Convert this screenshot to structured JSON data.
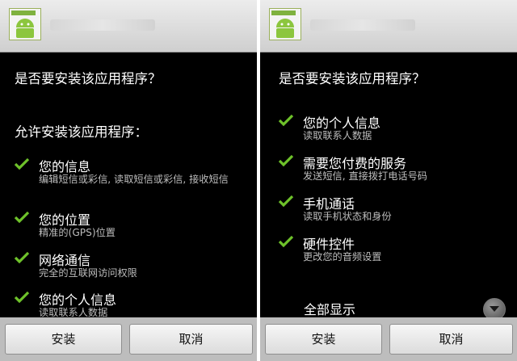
{
  "left": {
    "question": "是否要安装该应用程序？",
    "section": "允许安装该应用程序：",
    "permissions": [
      {
        "title": "您的信息",
        "desc": "编辑短信或彩信, 读取短信或彩信, 接收短信"
      },
      {
        "title": "您的位置",
        "desc": "精准的(GPS)位置"
      },
      {
        "title": "网络通信",
        "desc": "完全的互联网访问权限"
      },
      {
        "title": "您的个人信息",
        "desc": "读取联系人数据"
      }
    ],
    "install_label": "安装",
    "cancel_label": "取消"
  },
  "right": {
    "question": "是否要安装该应用程序？",
    "permissions": [
      {
        "title": "您的个人信息",
        "desc": "读取联系人数据"
      },
      {
        "title": "需要您付费的服务",
        "desc": "发送短信, 直接拨打电话号码"
      },
      {
        "title": "手机通话",
        "desc": "读取手机状态和身份"
      },
      {
        "title": "硬件控件",
        "desc": "更改您的音频设置"
      }
    ],
    "show_all_label": "全部显示",
    "install_label": "安装",
    "cancel_label": "取消"
  },
  "colors": {
    "check_green": "#6ec22a",
    "background": "#000000",
    "button_bar": "#bdbdbd"
  },
  "icons": [
    "android-app-icon",
    "check-icon",
    "chevron-down-icon"
  ]
}
